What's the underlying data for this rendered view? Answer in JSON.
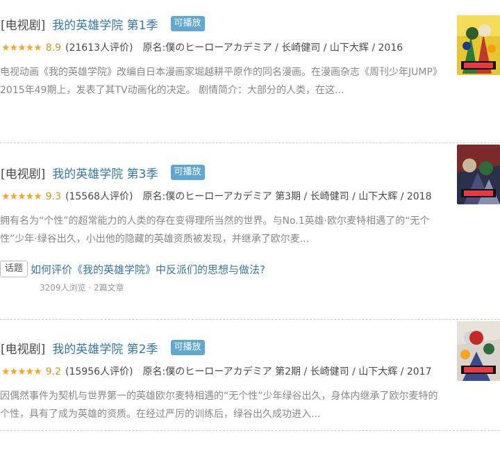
{
  "results": [
    {
      "category": "[电视剧]",
      "title": "我的英雄学院 第1季",
      "playable": "可播放",
      "stars": "★★★★★",
      "score": "8.9",
      "votes": "(21613人评价)",
      "origin": "原名:僕のヒーローアカデミア / 长崎健司 / 山下大辉 / 2016",
      "desc": "电视动画《我的英雄学院》改编自日本漫画家堀越耕平原作的同名漫画。在漫画杂志《周刊少年JUMP》2015年49期上，发表了其TV动画化的决定。 剧情简介：大部分的人类，在这..."
    },
    {
      "category": "[电视剧]",
      "title": "我的英雄学院 第3季",
      "playable": "可播放",
      "stars": "★★★★★",
      "score": "9.3",
      "votes": "(15568人评价)",
      "origin": "原名:僕のヒーローアカデミア 第3期 / 长崎健司 / 山下大辉 / 2018",
      "desc": "拥有名为“个性”的超常能力的人类的存在变得理所当然的世界。与No.1英雄·欧尔麦特相遇了的“无个性”少年·绿谷出久，小出他的隐藏的英雄资质被发现，并继承了欧尔麦...",
      "topic": {
        "tag": "话题",
        "link": "如何评价《我的英雄学院》中反派们的思想与做法?",
        "stats": "3209人浏览 · 2篇文章"
      }
    },
    {
      "category": "[电视剧]",
      "title": "我的英雄学院 第2季",
      "playable": "可播放",
      "stars": "★★★★★",
      "score": "9.2",
      "votes": "(15956人评价)",
      "origin": "原名:僕のヒーローアカデミア 第2期 / 长崎健司 / 山下大辉 / 2017",
      "desc": "因偶然事件为契机与世界第一的英雄欧尔麦特相遇的“无个性”少年绿谷出久，身体内继承了欧尔麦特的个性，具有了成为英雄的资质。在经过严厉的训练后，绿谷出久成功进入..."
    }
  ],
  "colors": {
    "link": "#3377aa",
    "badge": "#5fa8d3",
    "star": "#f5a623"
  }
}
